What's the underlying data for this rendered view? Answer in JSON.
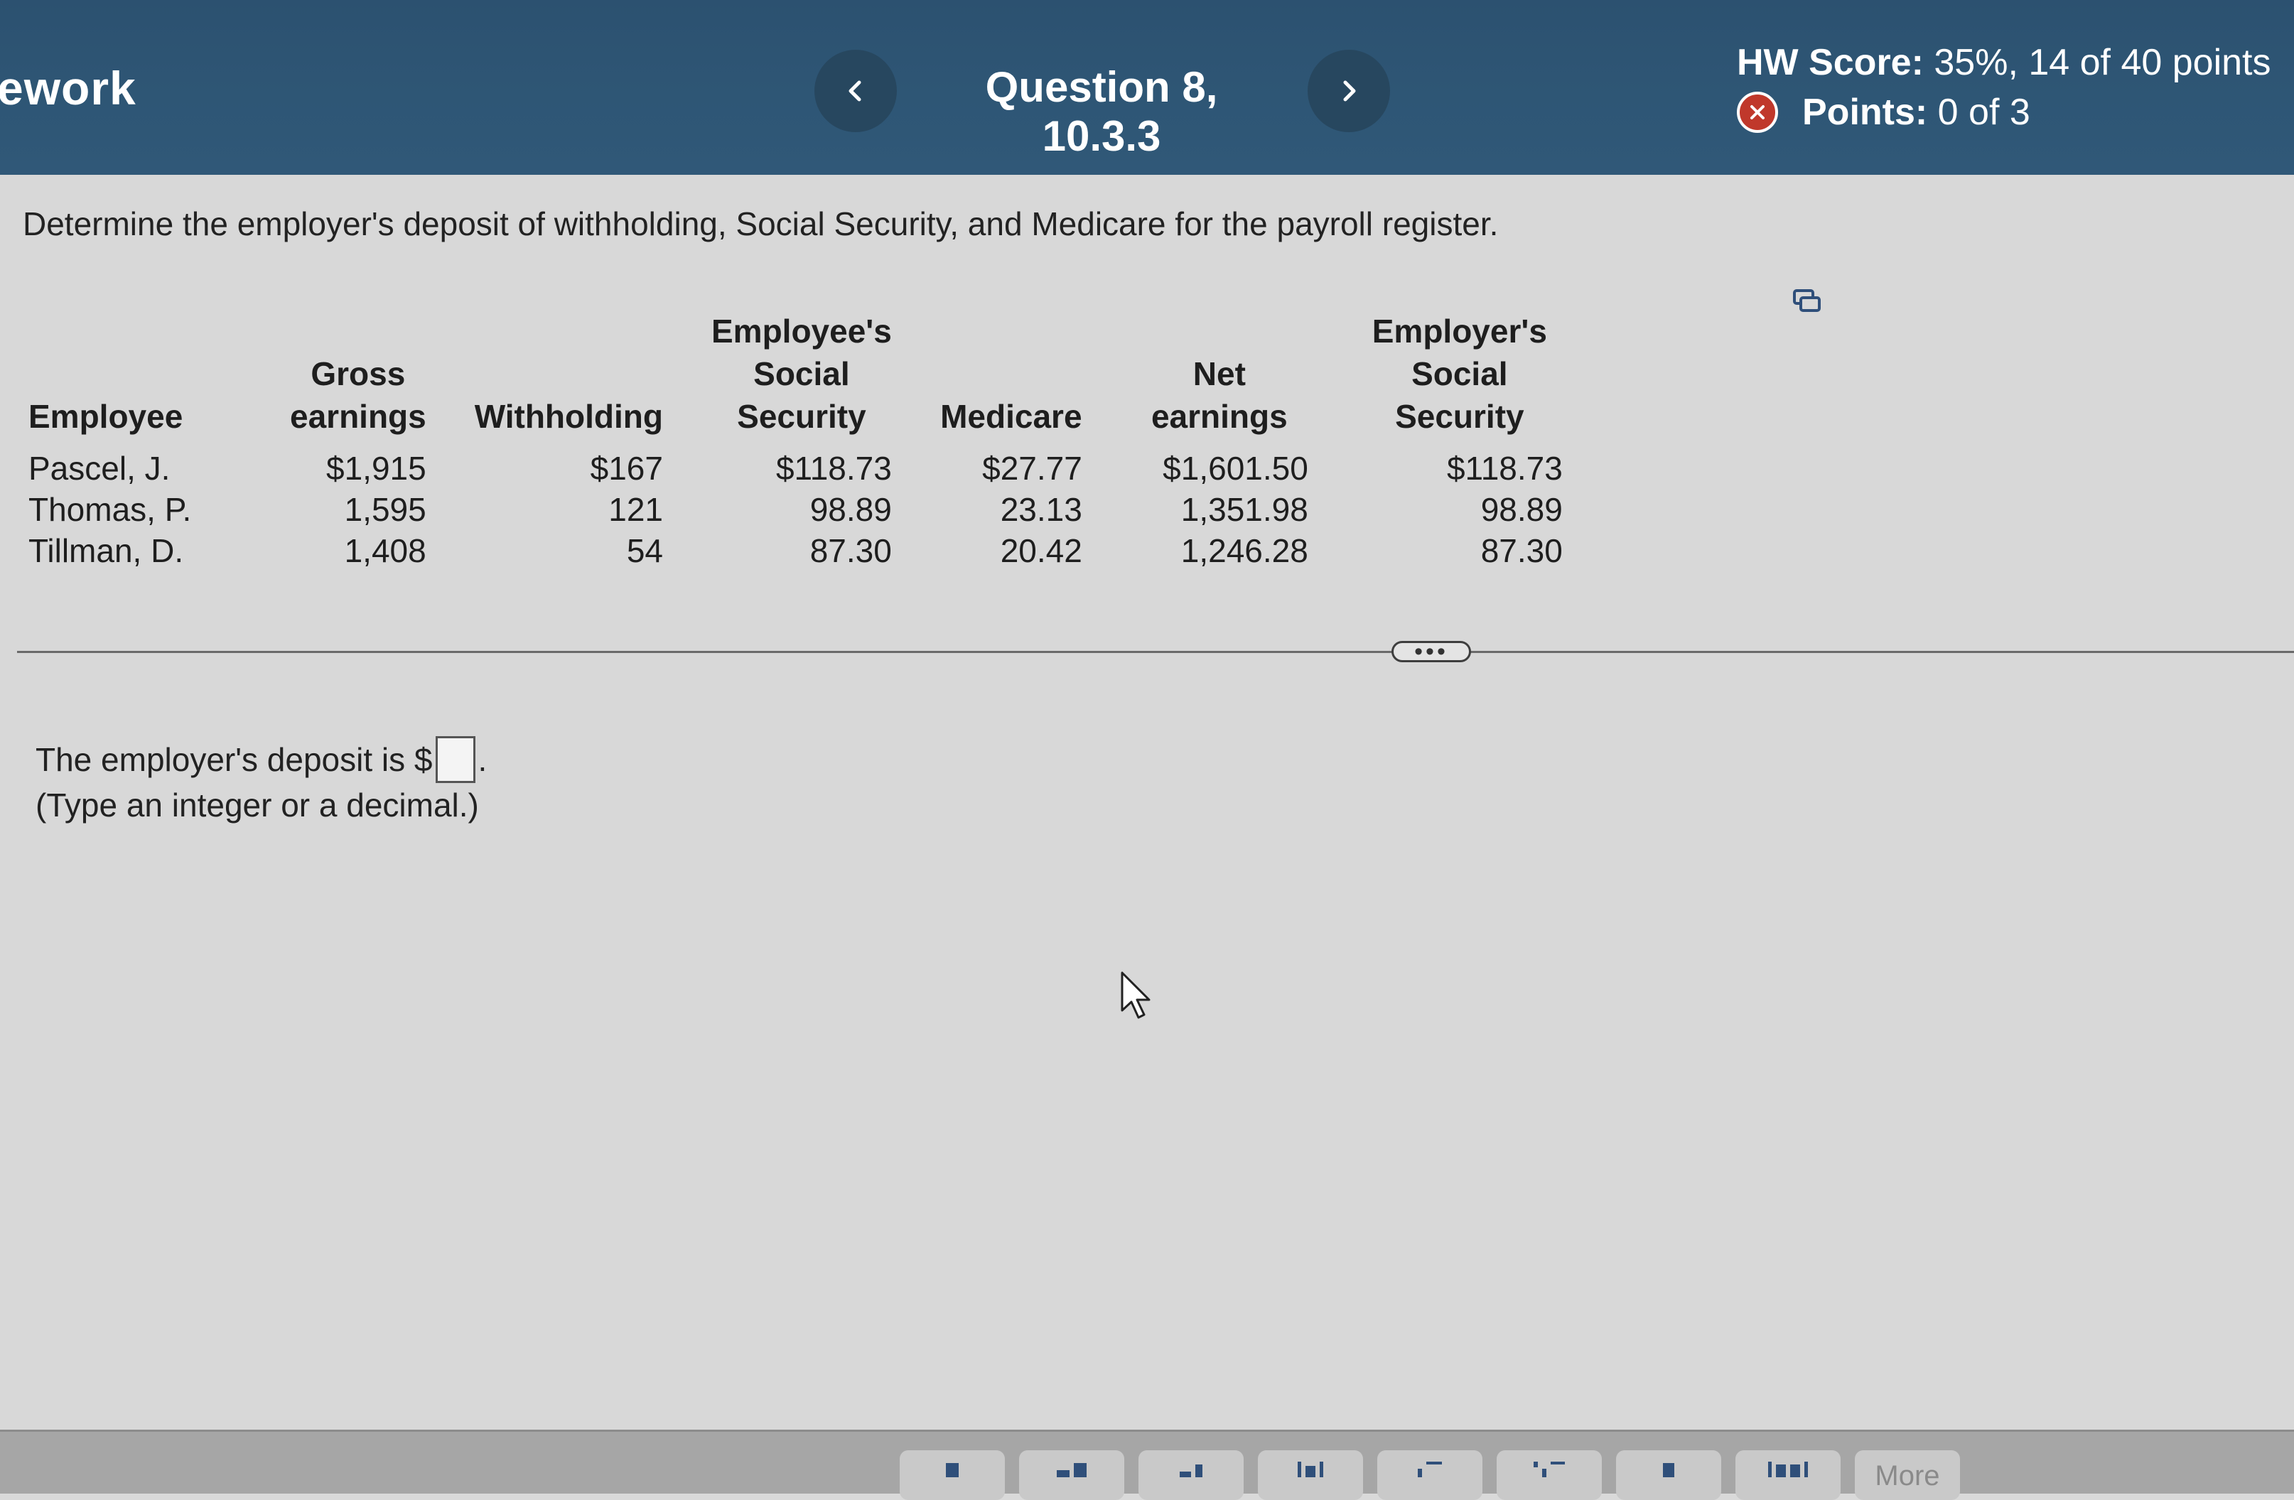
{
  "header": {
    "app_title": "ework",
    "question_title": "Question 8, 10.3.3",
    "hw_score_label": "HW Score:",
    "hw_score_value": "35%, 14 of 40 points",
    "points_label": "Points:",
    "points_value": "0 of 3",
    "icons": {
      "prev": "chevron-left-icon",
      "next": "chevron-right-icon",
      "status": "x-circle-icon"
    },
    "status_color": "#c0382b"
  },
  "question": {
    "prompt": "Determine the employer's deposit of withholding, Social Security, and Medicare for the payroll register.",
    "table": {
      "headers": [
        "Employee",
        "Gross earnings",
        "Withholding",
        "Employee's Social Security",
        "Medicare",
        "Net earnings",
        "Employer's Social Security"
      ],
      "rows": [
        [
          "Pascel, J.",
          "$1,915",
          "$167",
          "$118.73",
          "$27.77",
          "$1,601.50",
          "$118.73"
        ],
        [
          "Thomas, P.",
          "1,595",
          "121",
          "98.89",
          "23.13",
          "1,351.98",
          "98.89"
        ],
        [
          "Tillman, D.",
          "1,408",
          "54",
          "87.30",
          "20.42",
          "1,246.28",
          "87.30"
        ]
      ]
    },
    "more_handle": "•••",
    "answer_prefix": "The employer's deposit is $",
    "answer_value": "",
    "answer_suffix": ".",
    "hint": "(Type an integer or a decimal.)"
  },
  "toolbar": {
    "more_label": "More"
  }
}
